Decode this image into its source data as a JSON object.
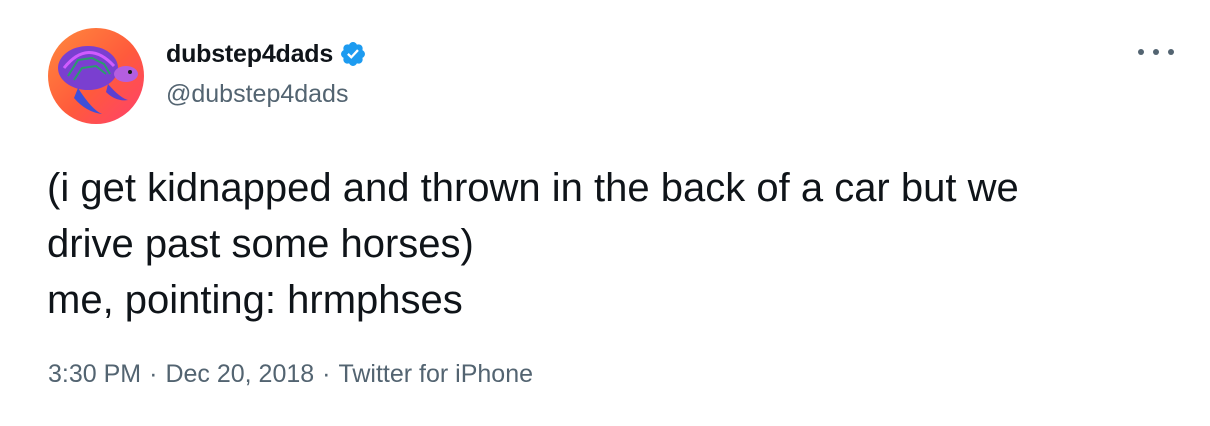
{
  "author": {
    "display_name": "dubstep4dads",
    "handle": "@dubstep4dads",
    "verified": true,
    "avatar_icon": "turtle-avatar"
  },
  "tweet": {
    "text": "(i get kidnapped and thrown in the back of a car but we\ndrive past some horses)\nme, pointing: hrmphses",
    "time": "3:30 PM",
    "separator": "·",
    "date": "Dec 20, 2018",
    "source": "Twitter for iPhone"
  },
  "colors": {
    "verified_blue": "#1d9bf0",
    "secondary_text": "#536471",
    "primary_text": "#0f1419"
  },
  "icons": {
    "more": "more-icon",
    "verified": "verified-badge-icon"
  }
}
